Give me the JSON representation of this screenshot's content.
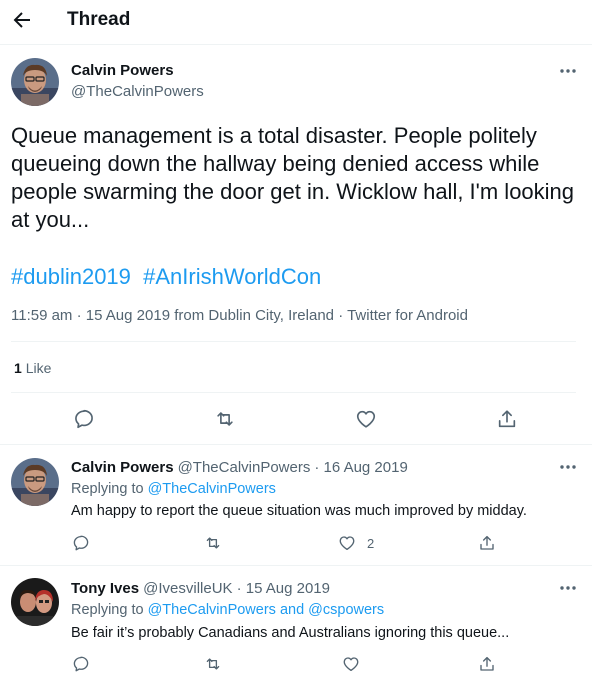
{
  "header": {
    "title": "Thread"
  },
  "main_tweet": {
    "author_name": "Calvin Powers",
    "author_handle": "@TheCalvinPowers",
    "text": "Queue management is a total disaster. People politely queueing down the hallway being denied access while people swarming the door get in. Wicklow hall, I'm looking at you...",
    "hashtags": [
      "#dublin2019",
      "#AnIrishWorldCon"
    ],
    "meta": {
      "time": "11:59 am",
      "date": "15 Aug 2019",
      "from_prefix": "from",
      "location": "Dublin City, Ireland",
      "source": "Twitter for Android",
      "sep": "·"
    },
    "likes": {
      "count": "1",
      "label": "Like"
    }
  },
  "replies": [
    {
      "author_name": "Calvin Powers",
      "author_handle": "@TheCalvinPowers",
      "date": "· 16 Aug 2019",
      "replying_prefix": "Replying to",
      "replying_to": "@TheCalvinPowers",
      "text": "Am happy to report the queue situation was much improved by midday.",
      "like_count": "2"
    },
    {
      "author_name": "Tony Ives",
      "author_handle": "@IvesvilleUK",
      "date": "· 15 Aug 2019",
      "replying_prefix": "Replying to",
      "replying_to": "@TheCalvinPowers and @cspowers",
      "text": "Be fair it’s probably Canadians and Australians ignoring this queue...",
      "like_count": ""
    }
  ],
  "colors": {
    "link": "#1d9bf0",
    "secondary": "#536471",
    "text": "#0f1419",
    "divider": "#eff3f4"
  },
  "icons": [
    "back-arrow-icon",
    "more-icon",
    "reply-icon",
    "retweet-icon",
    "like-icon",
    "share-icon"
  ]
}
